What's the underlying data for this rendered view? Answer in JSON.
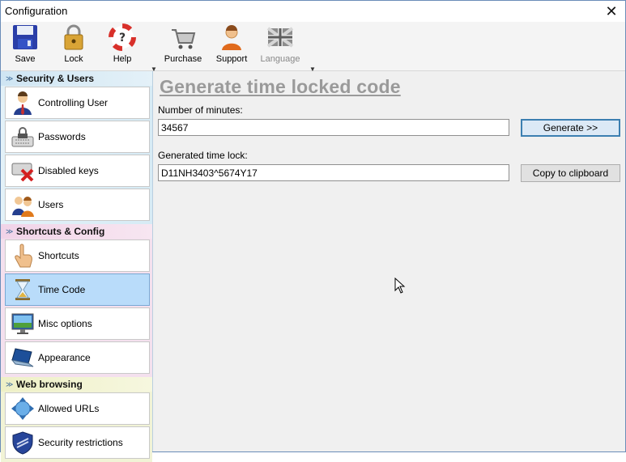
{
  "window": {
    "title": "Configuration",
    "close_glyph": "✕"
  },
  "toolbar": {
    "items": [
      {
        "label": "Save",
        "icon": "floppy-disk-icon"
      },
      {
        "label": "Lock",
        "icon": "padlock-icon"
      },
      {
        "label": "Help",
        "icon": "lifebuoy-icon"
      },
      {
        "label": "Purchase",
        "icon": "shopping-cart-icon"
      },
      {
        "label": "Support",
        "icon": "support-person-icon"
      },
      {
        "label": "Language",
        "icon": "uk-flag-icon"
      }
    ],
    "dropdown_glyph": "▼"
  },
  "sidebar": {
    "sections": [
      {
        "title": "Security & Users",
        "items": [
          "Controlling User",
          "Passwords",
          "Disabled keys",
          "Users"
        ]
      },
      {
        "title": "Shortcuts & Config",
        "items": [
          "Shortcuts",
          "Time Code",
          "Misc options",
          "Appearance"
        ]
      },
      {
        "title": "Web browsing",
        "items": [
          "Allowed URLs",
          "Security restrictions"
        ]
      }
    ],
    "selected": "Time Code",
    "chevron": "≫"
  },
  "main": {
    "heading": "Generate time locked code",
    "minutes_label": "Number of minutes:",
    "minutes_value": "34567",
    "generate_button": "Generate  >>",
    "timelock_label": "Generated time lock:",
    "timelock_value": "D11NH3403^5674Y17",
    "copy_button": "Copy to clipboard"
  },
  "colors": {
    "selected_item": "#b9dcfa",
    "default_button_border": "#3c7fb1",
    "heading": "#9a9a9a"
  }
}
